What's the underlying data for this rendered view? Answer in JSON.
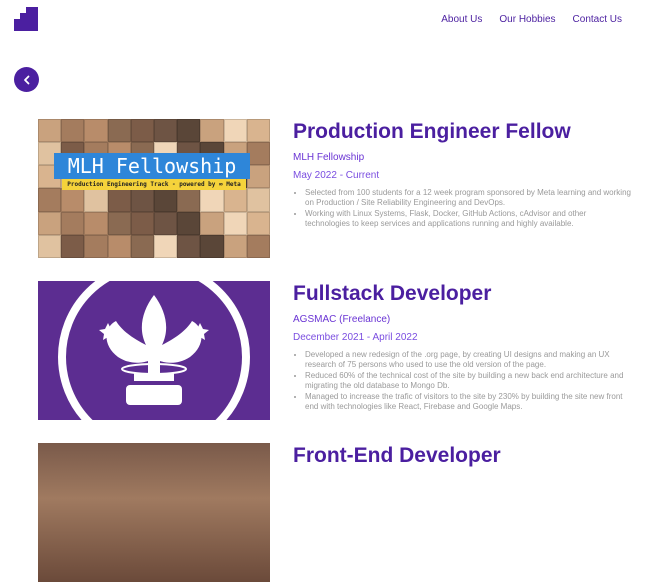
{
  "nav": {
    "links": [
      "About Us",
      "Our Hobbies",
      "Contact Us"
    ]
  },
  "colors": {
    "accent": "#4b1fa0",
    "subtitle": "#6a34d4",
    "body_text": "#9a9a9a",
    "fellowship_banner": "#2e86d9",
    "scout_purple": "#5c2d91"
  },
  "icons": {
    "logo": "blocks-logo-icon",
    "back": "chevron-left-icon"
  },
  "experiences": [
    {
      "title": "Production Engineer Fellow",
      "org": "MLH Fellowship",
      "date": "May 2022 - Current",
      "image_banner": "MLH Fellowship",
      "image_subbanner": "Production Engineering Track - powered by ∞ Meta",
      "bullets": [
        "Selected from 100 students for a 12 week program sponsored by Meta learning and working on Production / Site Reliability Engineering and DevOps.",
        "Working with Linux Systems, Flask, Docker, GitHub Actions, cAdvisor and other technologies to keep services and applications running and highly available."
      ]
    },
    {
      "title": "Fullstack Developer",
      "org": "AGSMAC (Freelance)",
      "date": "December 2021 - April 2022",
      "bullets": [
        "Developed a new redesign of the .org page, by creating UI designs and making an UX research of 75 persons who used to use the old version of the page.",
        "Reduced 60% of the technical cost of the site by building a new back end architecture and migrating the old database to Mongo Db.",
        "Managed to increase the trafic of visitors to the site by 230% by building the site new front end with technologies like React, Firebase and Google Maps."
      ]
    },
    {
      "title": "Front-End Developer"
    }
  ]
}
